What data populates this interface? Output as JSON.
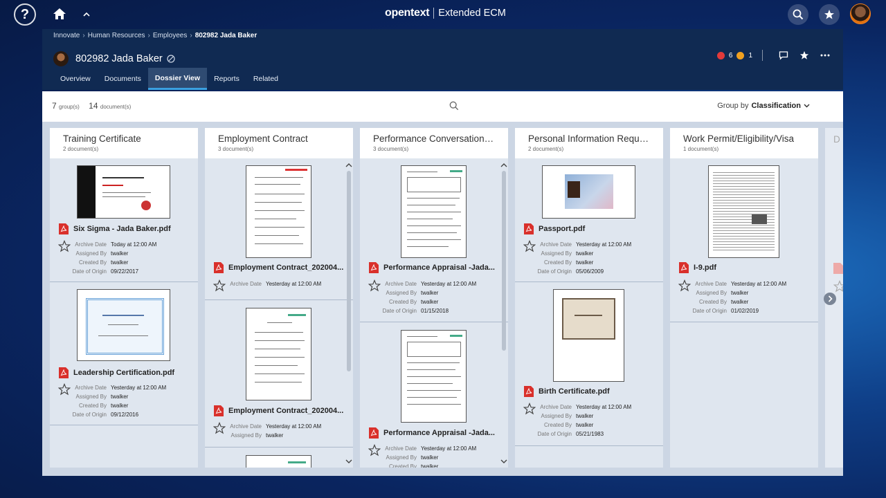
{
  "topbar": {
    "brand": "opentext",
    "product": "Extended ECM"
  },
  "breadcrumb": [
    "Innovate",
    "Human Resources",
    "Employees"
  ],
  "breadcrumb_current": "802982 Jada Baker",
  "object": {
    "name": "802982 Jada Baker"
  },
  "header_actions": {
    "red_count": "6",
    "orange_count": "1"
  },
  "tabs": [
    "Overview",
    "Documents",
    "Dossier View",
    "Reports",
    "Related"
  ],
  "active_tab": "Dossier View",
  "toolbar": {
    "groups_count": "7",
    "groups_label": "group(s)",
    "docs_count": "14",
    "docs_label": "document(s)",
    "group_by_label": "Group by",
    "group_by_value": "Classification"
  },
  "meta_keys": {
    "archive": "Archive Date",
    "assigned": "Assigned By",
    "created": "Created By",
    "origin": "Date of Origin"
  },
  "columns": [
    {
      "title": "Training Certificate",
      "count": "2 document(s)",
      "docs": [
        {
          "name": "Six Sigma - Jada Baker.pdf",
          "archive": "Today at 12:00 AM",
          "assigned": "twalker",
          "created": "twalker",
          "origin": "09/22/2017"
        },
        {
          "name": "Leadership Certification.pdf",
          "archive": "Yesterday at 12:00 AM",
          "assigned": "twalker",
          "created": "twalker",
          "origin": "09/12/2016"
        }
      ]
    },
    {
      "title": "Employment Contract",
      "count": "3 document(s)",
      "docs": [
        {
          "name": "Employment Contract_202004...",
          "archive": "Yesterday at 12:00 AM"
        },
        {
          "name": "Employment Contract_202004...",
          "archive": "Yesterday at 12:00 AM",
          "assigned": "twalker"
        }
      ]
    },
    {
      "title": "Performance Conversations (YE...",
      "count": "3 document(s)",
      "docs": [
        {
          "name": "Performance Appraisal -Jada...",
          "archive": "Yesterday at 12:00 AM",
          "assigned": "twalker",
          "created": "twalker",
          "origin": "01/15/2018"
        },
        {
          "name": "Performance Appraisal -Jada...",
          "archive": "Yesterday at 12:00 AM",
          "assigned": "twalker",
          "created": "twalker"
        }
      ]
    },
    {
      "title": "Personal Information Request",
      "count": "2 document(s)",
      "docs": [
        {
          "name": "Passport.pdf",
          "archive": "Yesterday at 12:00 AM",
          "assigned": "twalker",
          "created": "twalker",
          "origin": "05/06/2009"
        },
        {
          "name": "Birth Certificate.pdf",
          "archive": "Yesterday at 12:00 AM",
          "assigned": "twalker",
          "created": "twalker",
          "origin": "05/21/1983"
        }
      ]
    },
    {
      "title": "Work Permit/Eligibility/Visa",
      "count": "1 document(s)",
      "docs": [
        {
          "name": "I-9.pdf",
          "archive": "Yesterday at 12:00 AM",
          "assigned": "twalker",
          "created": "twalker",
          "origin": "01/02/2019"
        }
      ]
    }
  ],
  "peek_column_initial": "D",
  "colors": {
    "accent": "#3aa0e0",
    "header_bg": "#102a52",
    "pdf_red": "#d9302b"
  }
}
